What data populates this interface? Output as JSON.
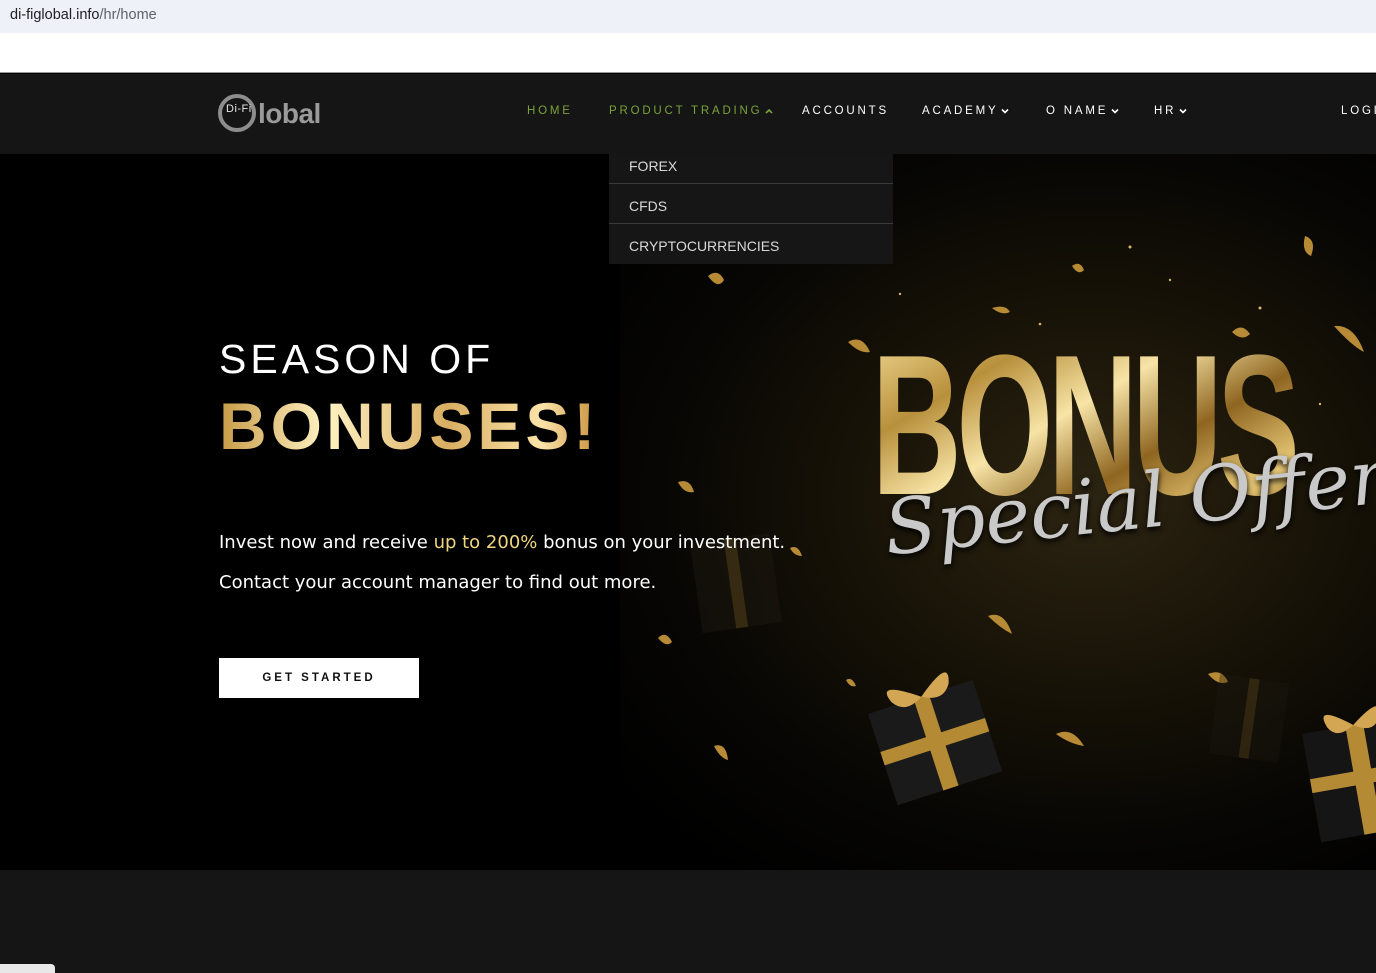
{
  "browser": {
    "url_domain": "di-figlobal.info",
    "url_path": "/hr/home"
  },
  "header": {
    "logo_small": "Di-Fi",
    "logo_word": "lobal",
    "nav": [
      {
        "label": "HOME",
        "active": true
      },
      {
        "label": "PRODUCT TRADING",
        "active": true,
        "expanded": true
      },
      {
        "label": "ACCOUNTS",
        "active": false
      },
      {
        "label": "ACADEMY",
        "active": false
      },
      {
        "label": "O NAME",
        "active": false
      },
      {
        "label": "HR",
        "active": false
      }
    ],
    "login": "LOGI"
  },
  "dropdown": {
    "items": [
      "FOREX",
      "CFDS",
      "CRYPTOCURRENCIES"
    ]
  },
  "hero": {
    "title_line1": "SEASON OF",
    "title_line2": "BONUSES!",
    "line1_pre": "Invest now and receive ",
    "line1_highlight": "up to 200%",
    "line1_post": " bonus on your investment.",
    "line2": "Contact your account manager to find out more.",
    "cta": "GET STARTED",
    "banner_word": "BONUS",
    "banner_script": "Special Offer"
  },
  "colors": {
    "nav_active": "#7aa33a",
    "header_bg": "#151515",
    "gold": "#d9ae62",
    "highlight": "#f0d77f"
  }
}
